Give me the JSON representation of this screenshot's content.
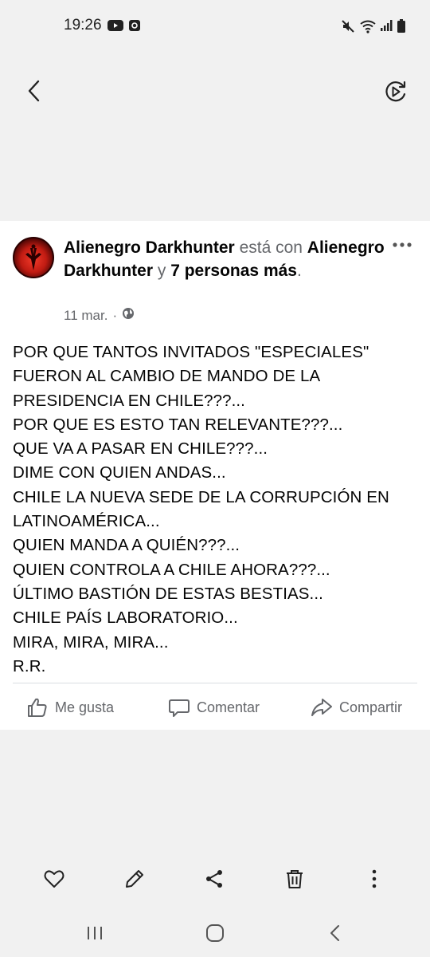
{
  "status_bar": {
    "time": "19:26",
    "icons": [
      "youtube-icon",
      "app-notification-icon",
      "mute-icon",
      "wifi-icon",
      "signal-icon",
      "battery-icon"
    ]
  },
  "top_bar": {
    "back_icon": "back-arrow-icon",
    "replay_icon": "video-replay-icon"
  },
  "post": {
    "author": "Alienegro Darkhunter",
    "with_text": "está con",
    "tagged_name": "Alienegro Darkhunter",
    "and_text": "y",
    "others": "7 personas más",
    "period": ".",
    "date": "11 mar.",
    "separator": "·",
    "privacy_icon": "globe-icon",
    "body_lines": [
      "POR QUE TANTOS INVITADOS \"ESPECIALES\"",
      "FUERON AL CAMBIO DE MANDO DE LA",
      "PRESIDENCIA EN CHILE???...",
      "POR QUE ES ESTO TAN RELEVANTE???...",
      "QUE VA A PASAR  EN CHILE???...",
      "DIME CON QUIEN ANDAS...",
      "CHILE LA NUEVA SEDE DE LA CORRUPCIÓN EN",
      "LATINOAMÉRICA...",
      "QUIEN MANDA A QUIÉN???...",
      "QUIEN CONTROLA A CHILE AHORA???...",
      "ÚLTIMO BASTIÓN DE ESTAS BESTIAS...",
      "CHILE PAÍS LABORATORIO...",
      "MIRA, MIRA, MIRA...",
      "R.R."
    ],
    "actions": {
      "like": "Me gusta",
      "comment": "Comentar",
      "share": "Compartir"
    }
  },
  "toolbar": {
    "icons": [
      "heart-icon",
      "edit-pencil-icon",
      "share-icon",
      "trash-icon",
      "more-vertical-icon"
    ]
  },
  "nav": {
    "icons": [
      "recent-apps-icon",
      "home-icon",
      "back-icon"
    ]
  },
  "colors": {
    "text": "#050505",
    "muted": "#65676b",
    "background": "#f1f1f1",
    "card": "#ffffff"
  }
}
